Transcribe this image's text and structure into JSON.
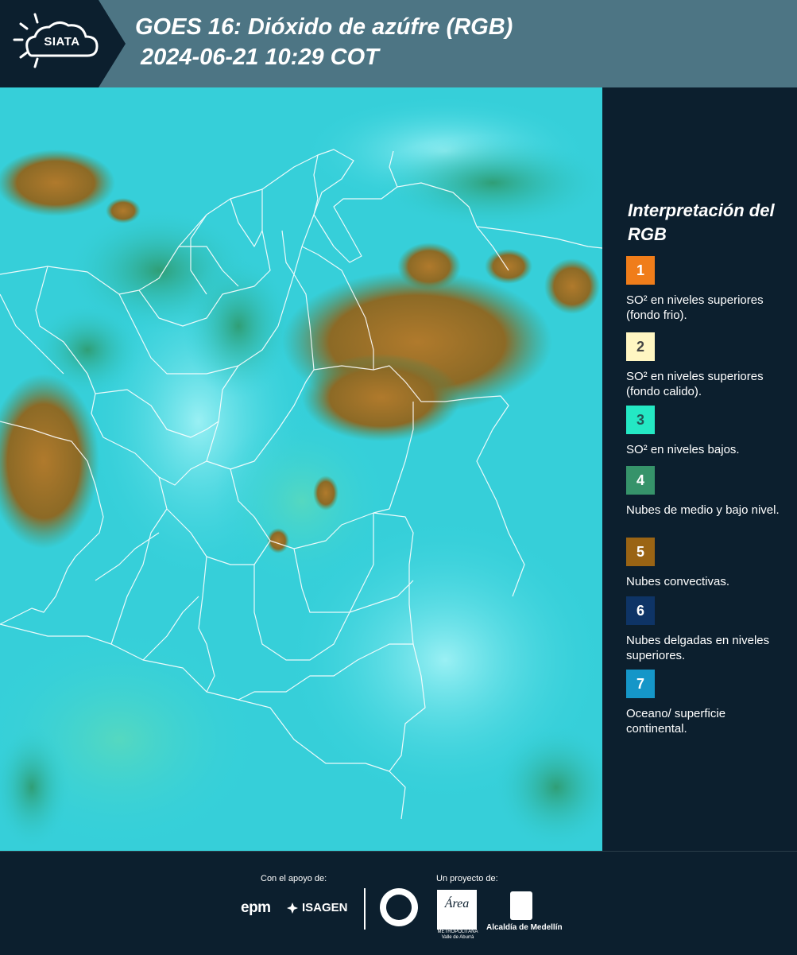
{
  "header": {
    "logo_text": "SIATA",
    "title": "GOES 16: Dióxido de azúfre (RGB)",
    "subtitle": "2024-06-21 10:29 COT"
  },
  "legend": {
    "title": "Interpretación del RGB",
    "items": [
      {
        "number": "1",
        "label": "SO² en niveles superiores (fondo frio).",
        "color": "#f07d1a",
        "text_color": "#ffffff"
      },
      {
        "number": "2",
        "label": "SO² en niveles superiores (fondo calido).",
        "color": "#fff6c2",
        "text_color": "#444444"
      },
      {
        "number": "3",
        "label": "SO² en niveles bajos.",
        "color": "#24e8c4",
        "text_color": "#225555"
      },
      {
        "number": "4",
        "label": "Nubes de medio y bajo nivel.",
        "color": "#36936a",
        "text_color": "#ffffff"
      },
      {
        "number": "5",
        "label": "Nubes convectivas.",
        "color": "#9a6414",
        "text_color": "#ffffff"
      },
      {
        "number": "6",
        "label": "Nubes delgadas en niveles superiores.",
        "color": "#0e3466",
        "text_color": "#ffffff"
      },
      {
        "number": "7",
        "label": "Oceano/ superficie continental.",
        "color": "#1596c8",
        "text_color": "#ffffff"
      }
    ]
  },
  "footer": {
    "support_label": "Con el apoyo de:",
    "project_label": "Un proyecto de:",
    "epm": "epm",
    "isagen": "ISAGEN",
    "area_logo": "Área",
    "area_sub": "METROPOLITANA Valle de Aburrá",
    "alcaldia": "Alcaldía de Medellín"
  }
}
